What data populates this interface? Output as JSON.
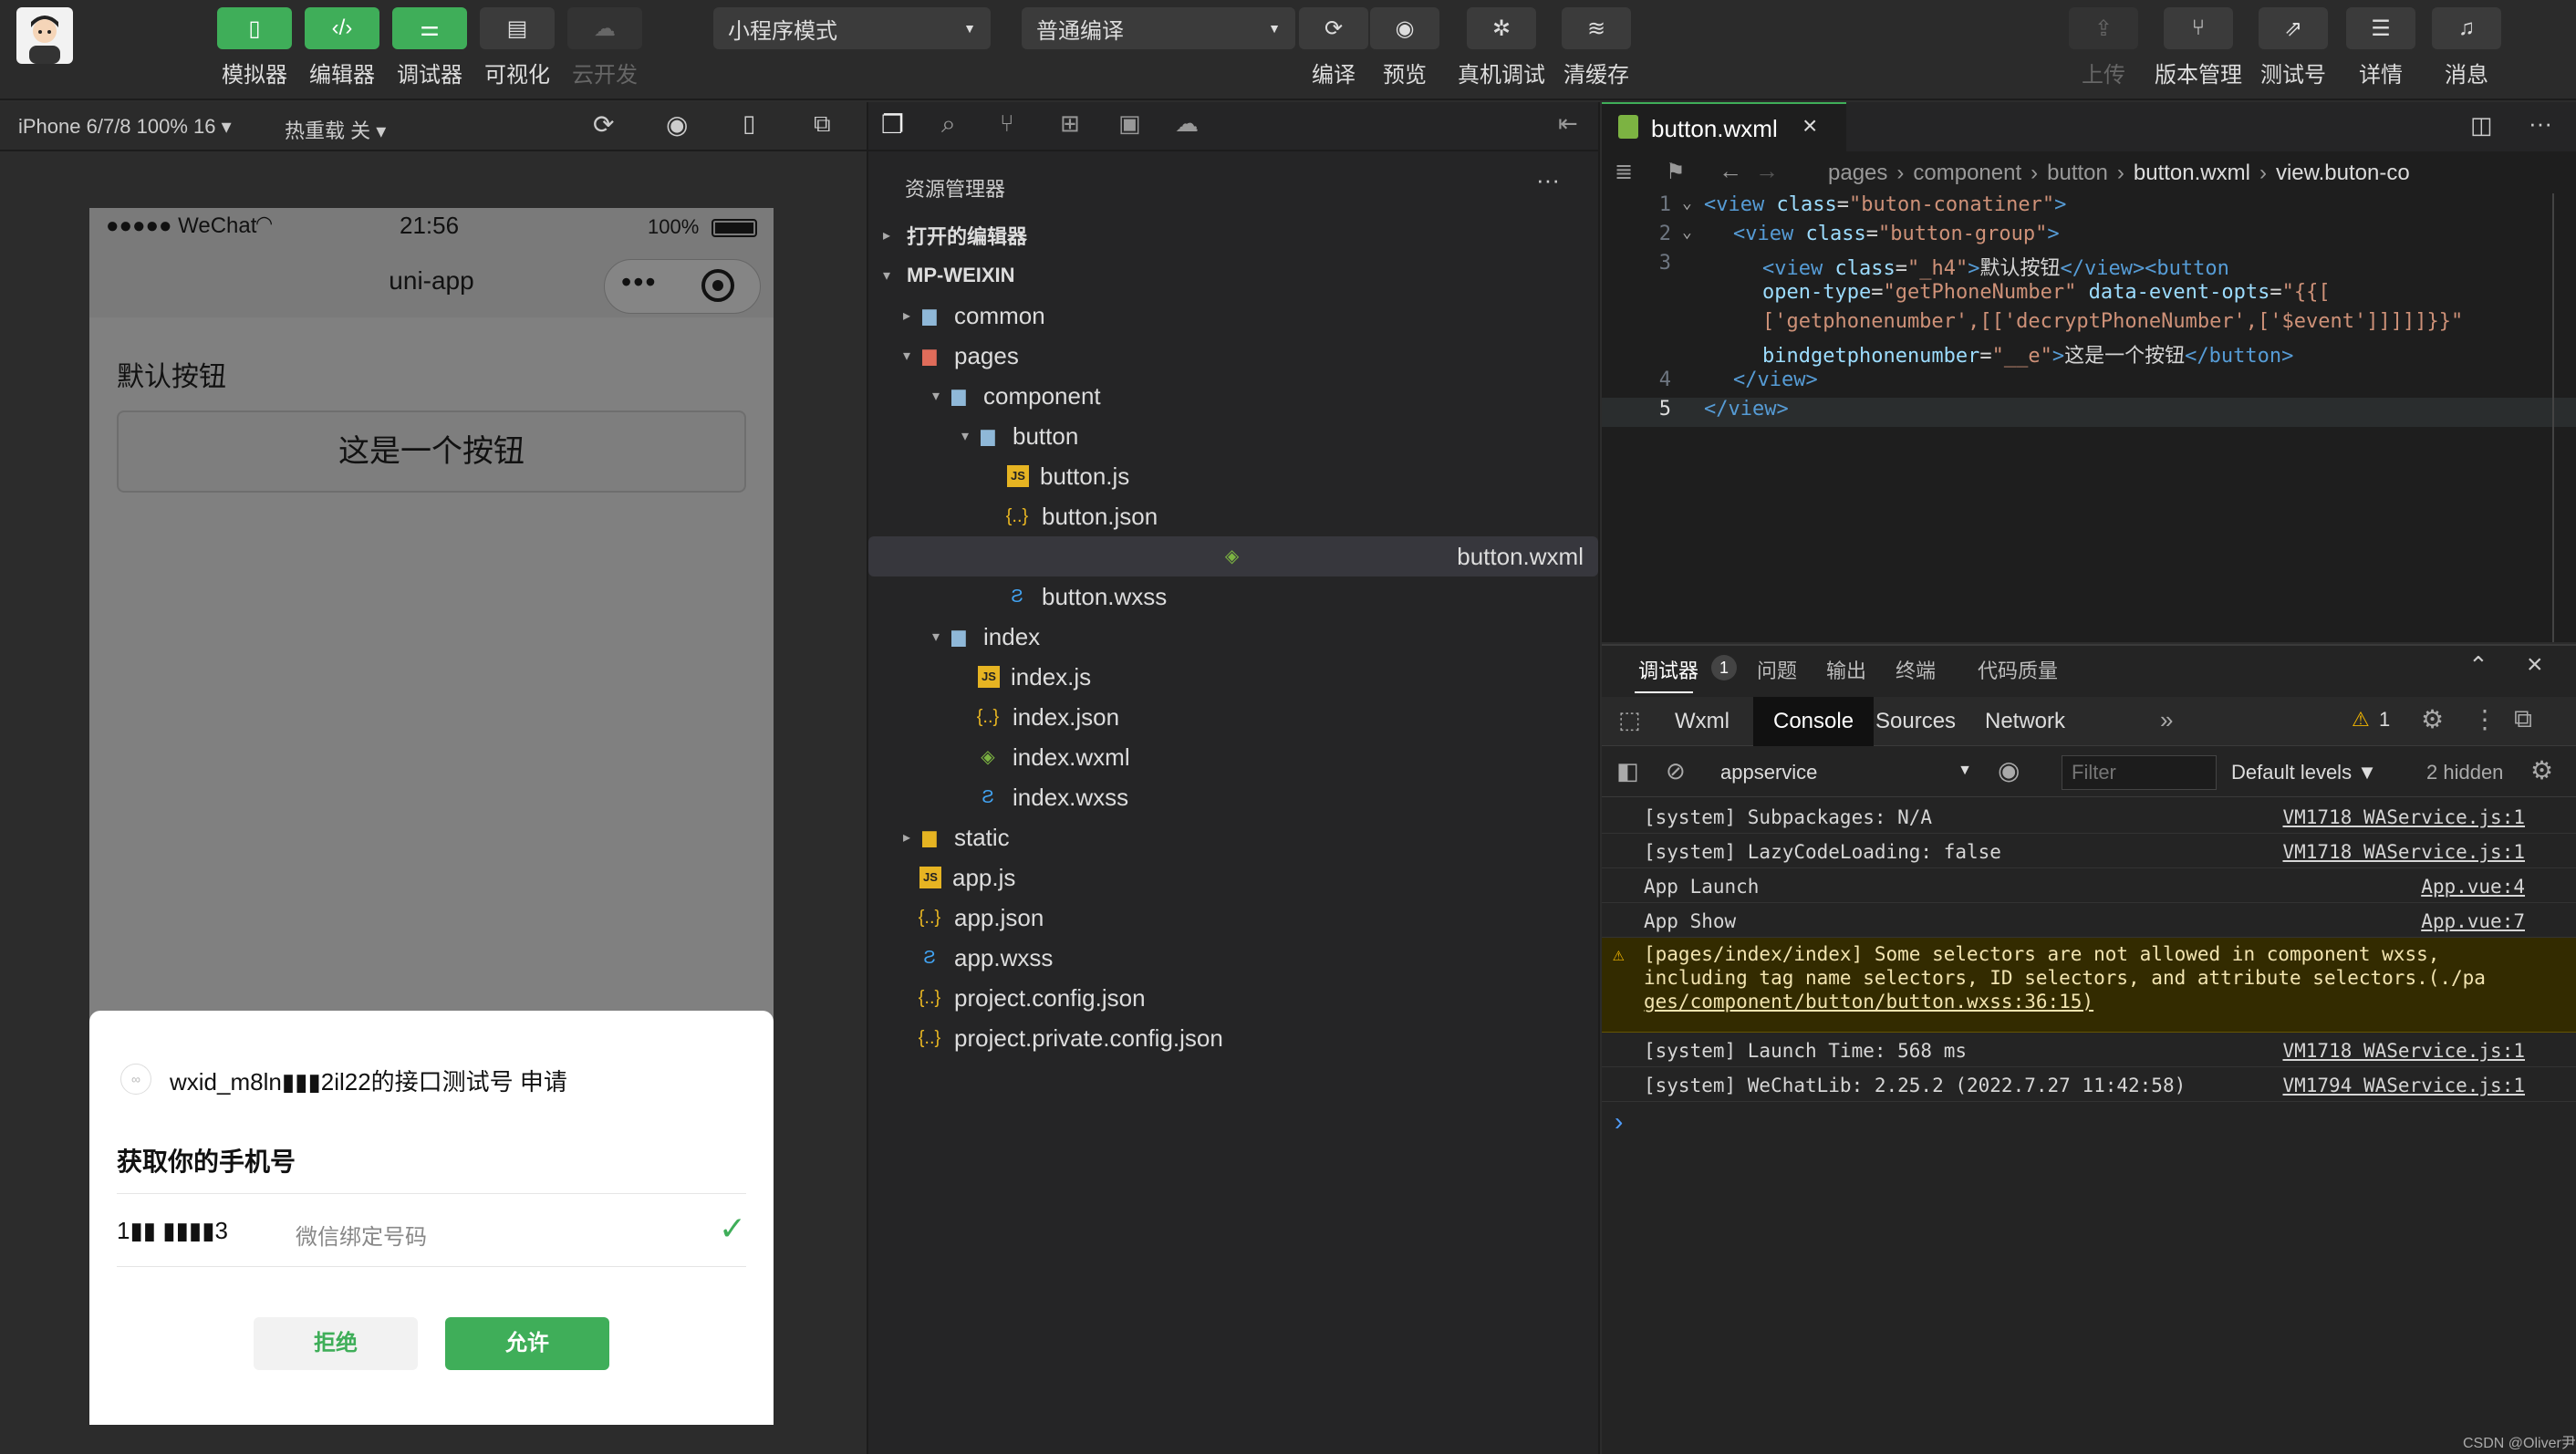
{
  "toolbar": {
    "left_buttons": [
      {
        "label": "模拟器",
        "icon": "phone-icon",
        "active": true
      },
      {
        "label": "编辑器",
        "icon": "code-icon",
        "active": true
      },
      {
        "label": "调试器",
        "icon": "debug-sliders-icon",
        "active": true
      },
      {
        "label": "可视化",
        "icon": "layout-icon",
        "active": false
      },
      {
        "label": "云开发",
        "icon": "cloud-icon",
        "disabled": true
      }
    ],
    "mode_select": "小程序模式",
    "compile_select": "普通编译",
    "middle_buttons": [
      {
        "label": "编译",
        "icon": "refresh-icon"
      },
      {
        "label": "预览",
        "icon": "eye-icon"
      },
      {
        "label": "真机调试",
        "icon": "bug-icon"
      },
      {
        "label": "清缓存",
        "icon": "layers-icon"
      }
    ],
    "right_buttons": [
      {
        "label": "上传",
        "icon": "upload-icon",
        "disabled": true
      },
      {
        "label": "版本管理",
        "icon": "branch-icon"
      },
      {
        "label": "测试号",
        "icon": "external-link-icon"
      },
      {
        "label": "详情",
        "icon": "menu-icon"
      },
      {
        "label": "消息",
        "icon": "bell-icon"
      }
    ]
  },
  "sim_bar": {
    "device": "iPhone 6/7/8 100% 16 ▾",
    "hot_reload": "热重载 关 ▾"
  },
  "phone": {
    "carrier": "●●●●● WeChat",
    "time": "21:56",
    "battery": "100%",
    "nav_title": "uni-app",
    "section_title": "默认按钮",
    "button_label": "这是一个按钮",
    "dialog": {
      "app_line": "wxid_m8ln▮▮▮2il22的接口测试号 申请",
      "title": "获取你的手机号",
      "phone_number": "1▮▮ ▮▮▮▮3",
      "phone_desc": "微信绑定号码",
      "reject": "拒绝",
      "allow": "允许"
    }
  },
  "explorer": {
    "title": "资源管理器",
    "open_editors": "打开的编辑器",
    "project": "MP-WEIXIN",
    "tree": [
      {
        "name": "common",
        "type": "folder",
        "depth": 1,
        "open": false
      },
      {
        "name": "pages",
        "type": "folder-red",
        "depth": 1,
        "open": true
      },
      {
        "name": "component",
        "type": "folder",
        "depth": 2,
        "open": true
      },
      {
        "name": "button",
        "type": "folder",
        "depth": 3,
        "open": true
      },
      {
        "name": "button.js",
        "type": "js",
        "depth": 4
      },
      {
        "name": "button.json",
        "type": "json",
        "depth": 4
      },
      {
        "name": "button.wxml",
        "type": "wxml",
        "depth": 4,
        "selected": true
      },
      {
        "name": "button.wxss",
        "type": "wxss",
        "depth": 4
      },
      {
        "name": "index",
        "type": "folder",
        "depth": 2,
        "open": true
      },
      {
        "name": "index.js",
        "type": "js",
        "depth": 3
      },
      {
        "name": "index.json",
        "type": "json",
        "depth": 3
      },
      {
        "name": "index.wxml",
        "type": "wxml",
        "depth": 3
      },
      {
        "name": "index.wxss",
        "type": "wxss",
        "depth": 3
      },
      {
        "name": "static",
        "type": "folder-yellow",
        "depth": 1,
        "open": false
      },
      {
        "name": "app.js",
        "type": "js",
        "depth": 1
      },
      {
        "name": "app.json",
        "type": "json",
        "depth": 1
      },
      {
        "name": "app.wxss",
        "type": "wxss",
        "depth": 1
      },
      {
        "name": "project.config.json",
        "type": "json",
        "depth": 1
      },
      {
        "name": "project.private.config.json",
        "type": "json",
        "depth": 1
      }
    ]
  },
  "editor": {
    "tab": "button.wxml",
    "breadcrumb": [
      "pages",
      "component",
      "button",
      "button.wxml",
      "view.buton-co"
    ],
    "lines": [
      {
        "n": "1",
        "html": "<span class='tag'>&lt;view</span> <span class='attr'>class</span>=<span class='str'>\"buton-conatiner\"</span><span class='tag'>&gt;</span>",
        "indent": 0
      },
      {
        "n": "2",
        "html": "<span class='tag'>&lt;view</span> <span class='attr'>class</span>=<span class='str'>\"button-group\"</span><span class='tag'>&gt;</span>",
        "indent": 1
      },
      {
        "n": "3",
        "html": "<span class='tag'>&lt;view</span> <span class='attr'>class</span>=<span class='str'>\"_h4\"</span><span class='tag'>&gt;</span>默认按钮<span class='tag'>&lt;/view&gt;&lt;button</span>",
        "indent": 2
      },
      {
        "n": "",
        "html": "<span class='attr'>open-type</span>=<span class='str'>\"getPhoneNumber\"</span> <span class='attr'>data-event-opts</span>=<span class='str'>\"{{[</span>",
        "indent": 2
      },
      {
        "n": "",
        "html": "<span class='str'>['getphonenumber',[['decryptPhoneNumber',['$event']]]]]}}\"</span>",
        "indent": 2
      },
      {
        "n": "",
        "html": "<span class='attr'>bindgetphonenumber</span>=<span class='str'>\"__e\"</span><span class='tag'>&gt;</span>这是一个按钮<span class='tag'>&lt;/button&gt;</span>",
        "indent": 2
      },
      {
        "n": "4",
        "html": "<span class='tag'>&lt;/view&gt;</span>",
        "indent": 1
      },
      {
        "n": "5",
        "html": "<span class='tag'>&lt;/view&gt;</span>",
        "indent": 0
      }
    ]
  },
  "devtools": {
    "top_tabs": [
      "调试器",
      "问题",
      "输出",
      "终端",
      "代码质量"
    ],
    "debugger_badge": "1",
    "panel_tabs": [
      "Wxml",
      "Console",
      "Sources",
      "Network"
    ],
    "warning_count": "1",
    "context": "appservice",
    "filter_placeholder": "Filter",
    "levels": "Default levels ▼",
    "hidden": "2 hidden",
    "logs": [
      {
        "text": "[system] Subpackages: N/A",
        "src": "VM1718 WAService.js:1"
      },
      {
        "text": "[system] LazyCodeLoading: false",
        "src": "VM1718 WAService.js:1"
      },
      {
        "text": "App Launch",
        "src": "App.vue:4"
      },
      {
        "text": "App Show",
        "src": "App.vue:7"
      }
    ],
    "warning": {
      "line1": "[pages/index/index] Some selectors are not allowed in component wxss,",
      "line2": "including tag name selectors, ID selectors, and attribute selectors.(./pa",
      "line3": "ges/component/button/button.wxss:36:15)"
    },
    "logs2": [
      {
        "text": "[system] Launch Time: 568 ms",
        "src": "VM1718 WAService.js:1"
      },
      {
        "text": "[system] WeChatLib: 2.25.2 (2022.7.27 11:42:58)",
        "src": "VM1794 WAService.js:1"
      }
    ],
    "prompt": "›"
  },
  "watermark": "CSDN @Oliver尹"
}
